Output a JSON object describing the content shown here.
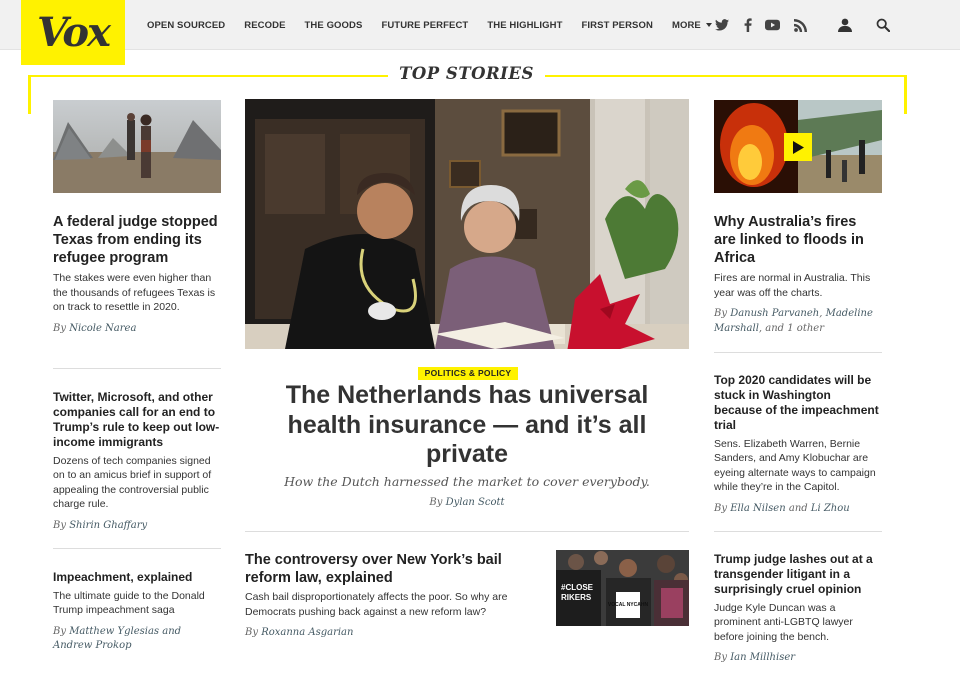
{
  "brand": {
    "logo_text": "Vox",
    "accent": "#fff200"
  },
  "nav": {
    "items": [
      "OPEN SOURCED",
      "RECODE",
      "THE GOODS",
      "FUTURE PERFECT",
      "THE HIGHLIGHT",
      "FIRST PERSON",
      "MORE"
    ]
  },
  "icons": [
    "twitter-icon",
    "facebook-icon",
    "youtube-icon",
    "rss-icon",
    "user-icon",
    "search-icon"
  ],
  "section": {
    "title": "TOP STORIES"
  },
  "left": [
    {
      "title": "A federal judge stopped Texas from ending its refugee program",
      "dek": "The stakes were even higher than the thousands of refugees Texas is on track to resettle in 2020.",
      "by": "By ",
      "authors": "Nicole Narea"
    },
    {
      "title": "Twitter, Microsoft, and other companies call for an end to Trump’s rule to keep out low-income immigrants",
      "dek": "Dozens of tech companies signed on to an amicus brief in support of appealing the controversial public charge rule.",
      "by": "By ",
      "authors": "Shirin Ghaffary"
    },
    {
      "title": "Impeachment, explained",
      "dek": "The ultimate guide to the Donald Trump impeachment saga",
      "by": "By ",
      "authors": "Matthew Yglesias and Andrew Prokop"
    }
  ],
  "center": {
    "tag": "POLITICS & POLICY",
    "title": "The Netherlands has universal health insurance — and it’s all private",
    "dek": "How the Dutch harnessed the market to cover everybody.",
    "by": "By ",
    "author": "Dylan Scott",
    "sub": {
      "title": "The controversy over New York’s bail reform law, explained",
      "dek": "Cash bail disproportionately affects the poor. So why are Democrats pushing back against a new reform law?",
      "by": "By ",
      "author": "Roxanna Asgarian"
    }
  },
  "right": [
    {
      "title": "Why Australia’s fires are linked to floods in Africa",
      "dek": "Fires are normal in Australia. This year was off the charts.",
      "by": "By ",
      "a1": "Danush Parvaneh",
      "sep1": ", ",
      "a2": "Madeline Marshall",
      "sep2": ", and 1 other"
    },
    {
      "title": "Top 2020 candidates will be stuck in Washington because of the impeachment trial",
      "dek": "Sens. Elizabeth Warren, Bernie Sanders, and Amy Klobuchar are eyeing alternate ways to campaign while they’re in the Capitol.",
      "by": "By ",
      "a1": "Ella Nilsen",
      "sep1": " and ",
      "a2": "Li Zhou"
    },
    {
      "title": "Trump judge lashes out at a transgender litigant in a surprisingly cruel opinion",
      "dek": "Judge Kyle Duncan was a prominent anti-LGBTQ lawyer before joining the bench.",
      "by": "By ",
      "a1": "Ian Millhiser"
    }
  ],
  "protest_sign": {
    "line1": "#CLOSE",
    "line2": "RIKERS",
    "shirt": "VOCAL NYCAHN"
  }
}
